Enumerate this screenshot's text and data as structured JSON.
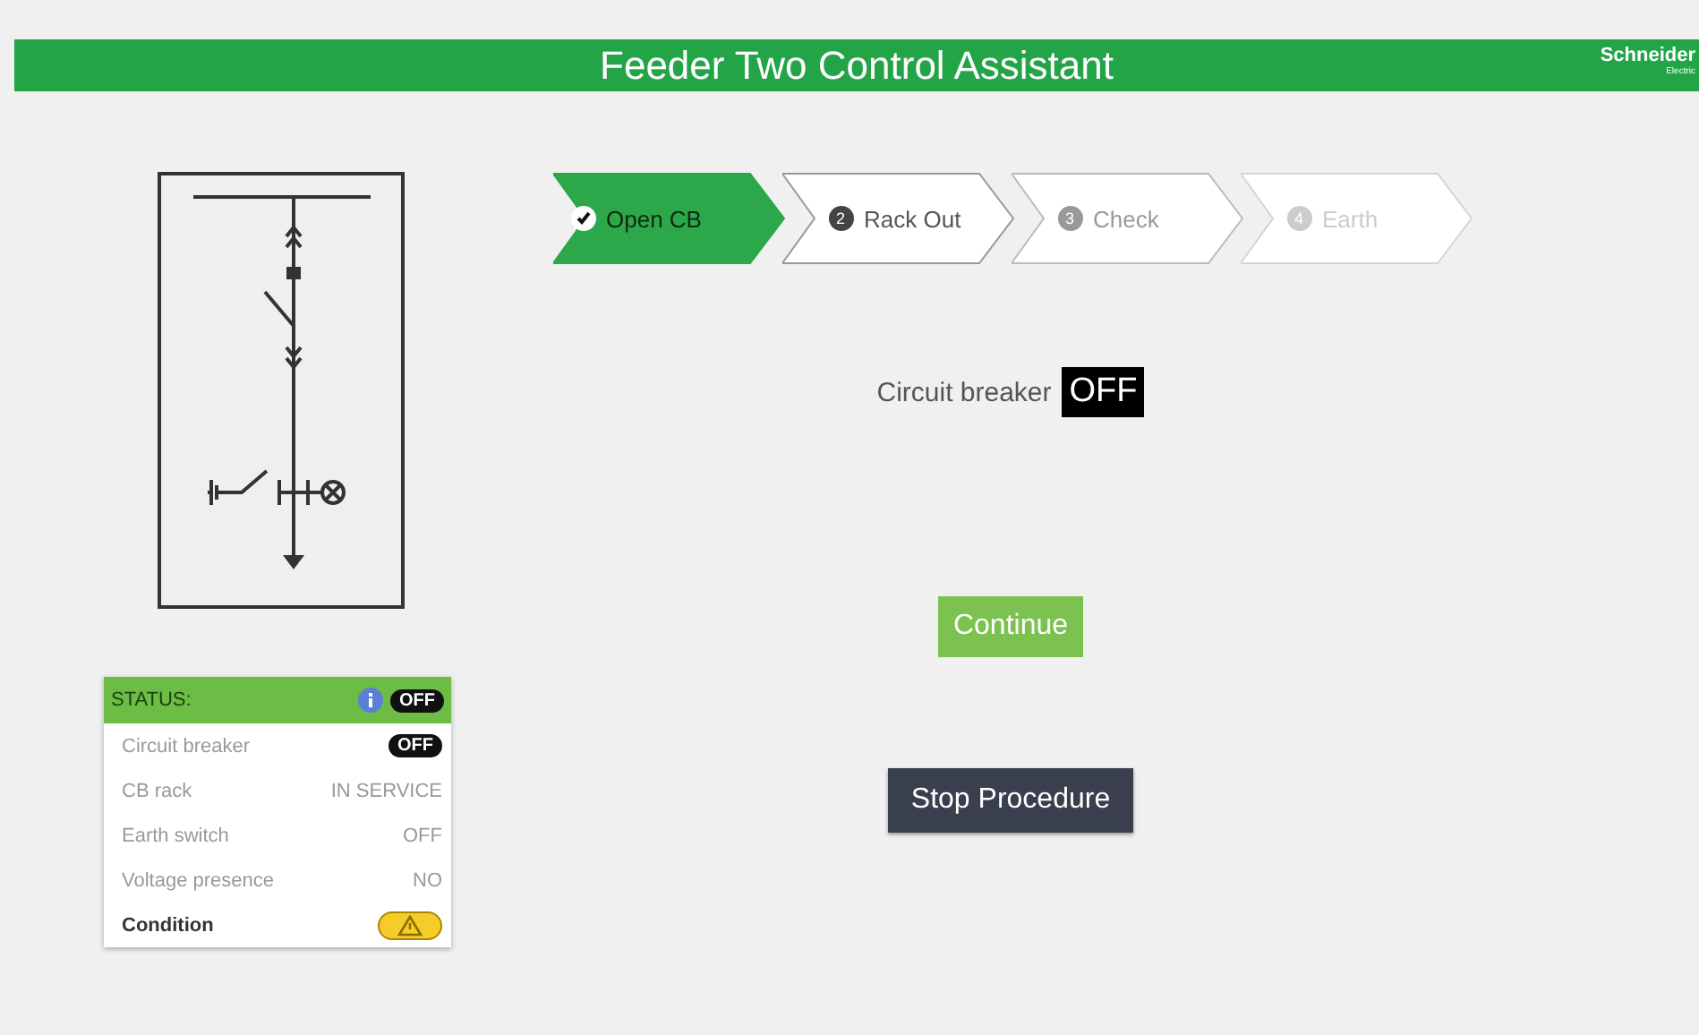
{
  "header": {
    "title": "Feeder Two Control Assistant",
    "logo": "Schneider",
    "logo_sub": "Electric"
  },
  "steps": [
    {
      "label": "Open CB",
      "done": true,
      "selected": false,
      "disabled": false
    },
    {
      "label": "Rack Out",
      "number": "2",
      "done": false,
      "selected": true,
      "disabled": false
    },
    {
      "label": "Check",
      "number": "3",
      "done": false,
      "selected": false,
      "disabled": false
    },
    {
      "label": "Earth",
      "number": "4",
      "done": false,
      "selected": false,
      "disabled": true
    }
  ],
  "breaker": {
    "label": "Circuit breaker",
    "value": "OFF"
  },
  "buttons": [
    {
      "label": "Continue",
      "kind": "primary"
    },
    {
      "label": "Stop Procedure",
      "kind": "dark"
    }
  ],
  "status": {
    "title": "STATUS:",
    "value": "OFF",
    "rows": [
      {
        "label": "Circuit breaker",
        "value": "OFF",
        "kind": "pill"
      },
      {
        "label": "CB rack",
        "value": "IN SERVICE",
        "kind": "text"
      },
      {
        "label": "Earth switch",
        "value": "OFF",
        "kind": "text"
      },
      {
        "label": "Voltage presence",
        "value": "NO",
        "kind": "text"
      },
      {
        "label": "Condition",
        "kind": "warning"
      }
    ]
  }
}
